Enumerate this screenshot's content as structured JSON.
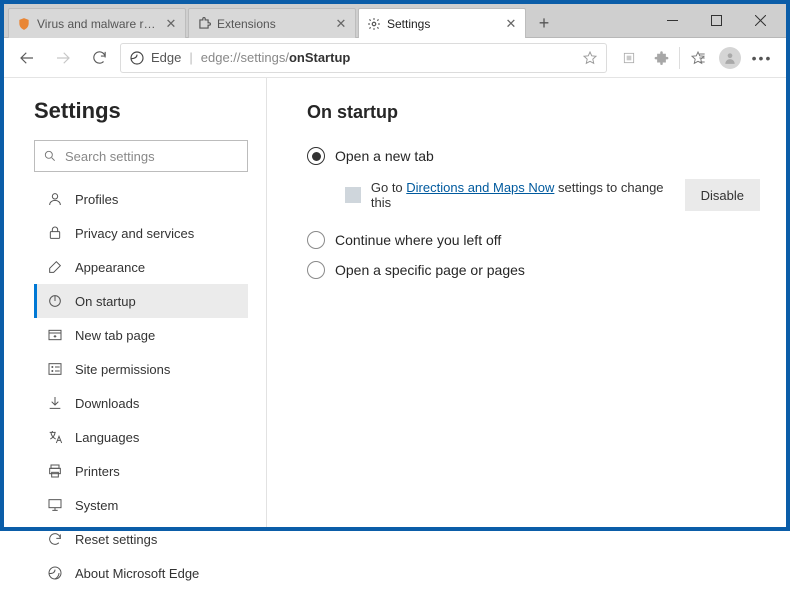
{
  "window": {
    "tabs": [
      {
        "title": "Virus and malware removal instr",
        "favicon": "shield-orange"
      },
      {
        "title": "Extensions",
        "favicon": "puzzle"
      },
      {
        "title": "Settings",
        "favicon": "gear"
      }
    ],
    "active_tab_index": 2
  },
  "addressbar": {
    "app_label": "Edge",
    "url_prefix": "edge://settings/",
    "url_path": "onStartup"
  },
  "sidebar": {
    "heading": "Settings",
    "search_placeholder": "Search settings",
    "items": [
      {
        "label": "Profiles",
        "icon": "person",
        "selected": false
      },
      {
        "label": "Privacy and services",
        "icon": "lock",
        "selected": false
      },
      {
        "label": "Appearance",
        "icon": "paint",
        "selected": false
      },
      {
        "label": "On startup",
        "icon": "power",
        "selected": true
      },
      {
        "label": "New tab page",
        "icon": "newtab",
        "selected": false
      },
      {
        "label": "Site permissions",
        "icon": "permissions",
        "selected": false
      },
      {
        "label": "Downloads",
        "icon": "download",
        "selected": false
      },
      {
        "label": "Languages",
        "icon": "languages",
        "selected": false
      },
      {
        "label": "Printers",
        "icon": "printer",
        "selected": false
      },
      {
        "label": "System",
        "icon": "system",
        "selected": false
      },
      {
        "label": "Reset settings",
        "icon": "reset",
        "selected": false
      },
      {
        "label": "About Microsoft Edge",
        "icon": "edge",
        "selected": false
      }
    ]
  },
  "main": {
    "title": "On startup",
    "options": [
      {
        "label": "Open a new tab",
        "checked": true
      },
      {
        "label": "Continue where you left off",
        "checked": false
      },
      {
        "label": "Open a specific page or pages",
        "checked": false
      }
    ],
    "extension_notice": {
      "prefix": "Go to ",
      "link": "Directions and Maps Now",
      "suffix": " settings to change this",
      "button": "Disable"
    }
  }
}
